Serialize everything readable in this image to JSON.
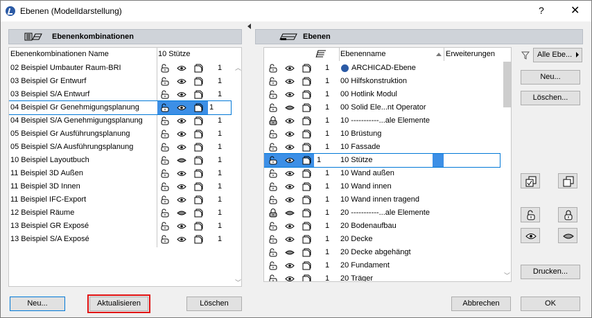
{
  "window": {
    "title": "Ebenen (Modelldarstellung)",
    "help": "?",
    "close": "✕"
  },
  "left": {
    "header": "Ebenenkombinationen",
    "col_name": "Ebenenkombinationen Name",
    "col_value": "10 Stütze",
    "rows": [
      {
        "name": "02 Beispiel Umbauter Raum-BRI",
        "num": "1"
      },
      {
        "name": "03 Beispiel Gr Entwurf",
        "num": "1"
      },
      {
        "name": "03 Beispiel S/A Entwurf",
        "num": "1"
      },
      {
        "name": "04 Beispiel Gr Genehmigungsplanung",
        "num": "1"
      },
      {
        "name": "04 Beispiel S/A Genehmigungsplanung",
        "num": "1"
      },
      {
        "name": "05 Beispiel Gr Ausführungsplanung",
        "num": "1"
      },
      {
        "name": "05 Beispiel S/A Ausführungsplanung",
        "num": "1"
      },
      {
        "name": "10 Beispiel Layoutbuch",
        "num": "1"
      },
      {
        "name": "11 Beispiel 3D Außen",
        "num": "1"
      },
      {
        "name": "11 Beispiel 3D Innen",
        "num": "1"
      },
      {
        "name": "11 Beispiel IFC-Export",
        "num": "1"
      },
      {
        "name": "12 Beispiel Räume",
        "num": "1"
      },
      {
        "name": "13 Beispiel GR Exposé",
        "num": "1"
      },
      {
        "name": "13 Beispiel S/A Exposé",
        "num": "1"
      }
    ],
    "buttons": {
      "new": "Neu...",
      "update": "Aktualisieren",
      "delete": "Löschen"
    }
  },
  "right": {
    "header": "Ebenen",
    "col_name": "Ebenenname",
    "col_ext": "Erweiterungen",
    "rows": [
      {
        "name": "ARCHICAD-Ebene",
        "num": "1"
      },
      {
        "name": "00 Hilfskonstruktion",
        "num": "1"
      },
      {
        "name": "00 Hotlink Modul",
        "num": "1"
      },
      {
        "name": "00 Solid Ele...nt Operator",
        "num": "1"
      },
      {
        "name": "10 -----------...ale Elemente",
        "num": "1"
      },
      {
        "name": "10 Brüstung",
        "num": "1"
      },
      {
        "name": "10 Fassade",
        "num": "1"
      },
      {
        "name": "10 Stütze",
        "num": "1"
      },
      {
        "name": "10 Wand außen",
        "num": "1"
      },
      {
        "name": "10 Wand innen",
        "num": "1"
      },
      {
        "name": "10 Wand innen tragend",
        "num": "1"
      },
      {
        "name": "20 -----------...ale Elemente",
        "num": "1"
      },
      {
        "name": "20 Bodenaufbau",
        "num": "1"
      },
      {
        "name": "20 Decke",
        "num": "1"
      },
      {
        "name": "20 Decke abgehängt",
        "num": "1"
      },
      {
        "name": "20 Fundament",
        "num": "1"
      },
      {
        "name": "20 Träger",
        "num": "1"
      }
    ],
    "filter": "Alle Ebe...",
    "buttons": {
      "new": "Neu...",
      "delete": "Löschen...",
      "print": "Drucken...",
      "cancel": "Abbrechen",
      "ok": "OK"
    }
  },
  "colors": {
    "selection": "#3c8fe6",
    "highlight_border": "#e01010",
    "header_bg": "#cfd3d9"
  }
}
